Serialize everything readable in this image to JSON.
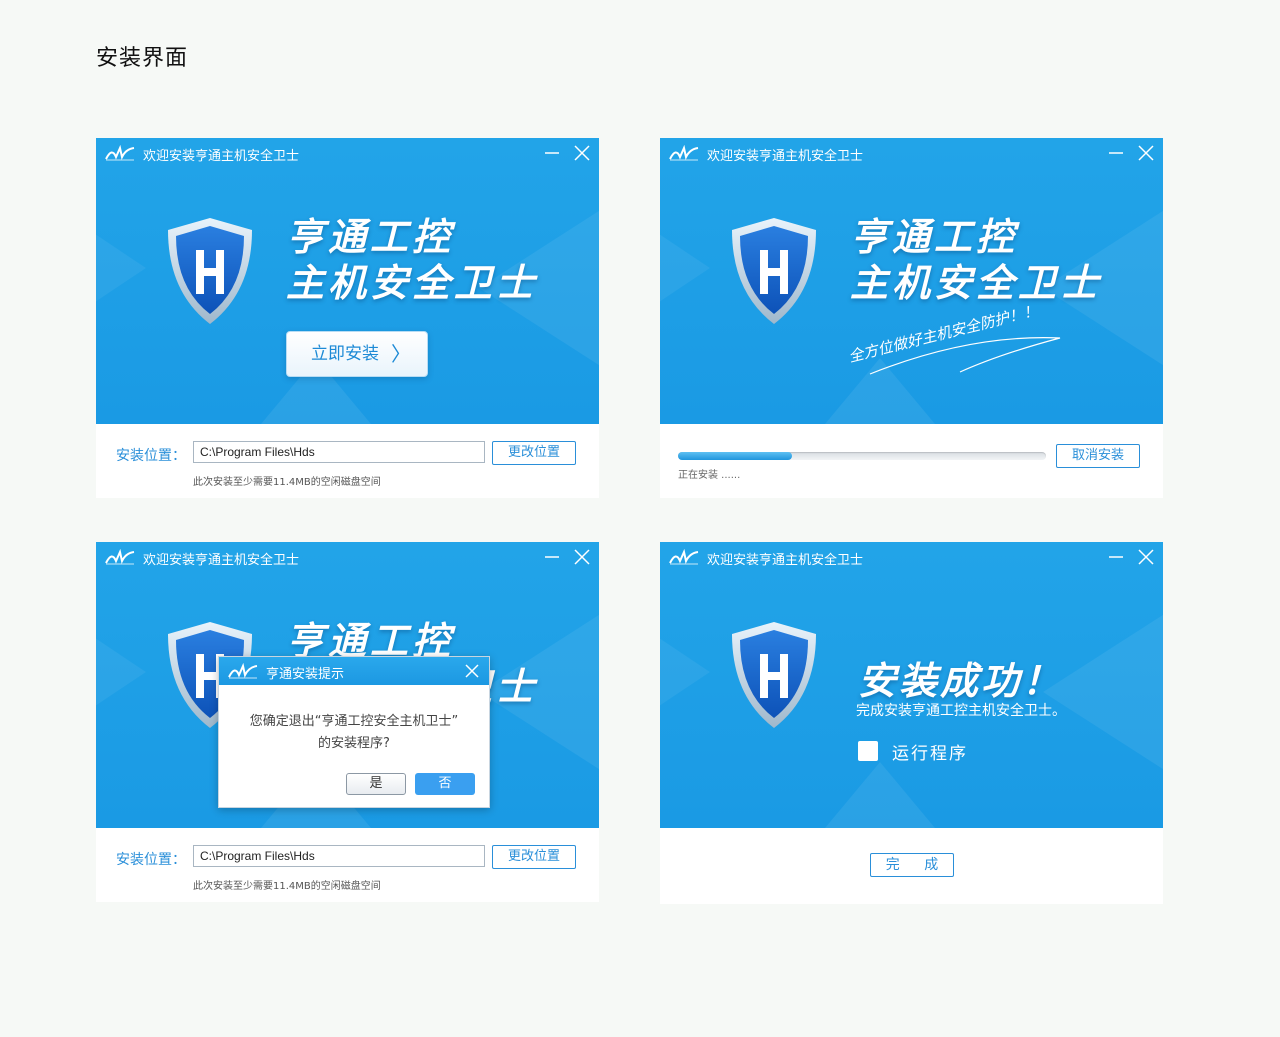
{
  "page": {
    "title": "安装界面"
  },
  "window": {
    "title": "欢迎安装亨通主机安全卫士"
  },
  "brand": {
    "line1": "亨通工控",
    "line2": "主机安全卫士"
  },
  "screen1": {
    "install_button": "立即安装",
    "location_label": "安装位置：",
    "path_value": "C:\\Program Files\\Hds",
    "change_button": "更改位置",
    "note": "此次安装至少需要11.4MB的空闲磁盘空间"
  },
  "screen2": {
    "slogan": "全方位做好主机安全防护！！",
    "progress": 0.31,
    "progress_text": "正在安装 ......",
    "cancel_button": "取消安装"
  },
  "screen3": {
    "location_label": "安装位置：",
    "path_value": "C:\\Program Files\\Hds",
    "change_button": "更改位置",
    "note": "此次安装至少需要11.4MB的空闲磁盘空间",
    "dialog": {
      "title": "亨通安装提示",
      "message_line1": "您确定退出“亨通工控安全主机卫士”",
      "message_line2": "的安装程序?",
      "yes_button": "是",
      "no_button": "否"
    }
  },
  "screen4": {
    "success_title": "安装成功！",
    "success_sub": "完成安装亨通工控主机安全卫士。",
    "run_label": "运行程序",
    "done_button": "完 成"
  },
  "colors": {
    "primary": "#1a9ae4",
    "accent": "#2a8fd9",
    "background": "#f6f9f6"
  },
  "icons": [
    "logo-icon",
    "minimize-icon",
    "close-icon",
    "shield-icon",
    "chevron-right-icon",
    "checkbox-icon"
  ]
}
